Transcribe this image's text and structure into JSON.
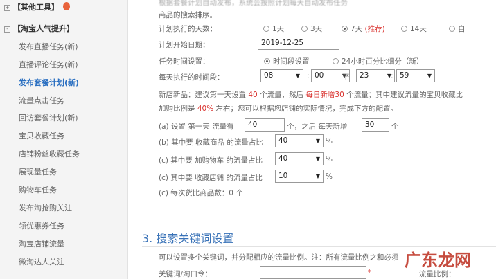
{
  "sidebar": {
    "groups": [
      {
        "label": "【其他工具】",
        "toggle": "+"
      },
      {
        "label": "【淘宝人气提升】",
        "toggle": "-"
      }
    ],
    "items": [
      {
        "label": "发布直播任务(新)"
      },
      {
        "label": "直播评论任务(新)"
      },
      {
        "label": "发布套餐计划(新)"
      },
      {
        "label": "流量点击任务"
      },
      {
        "label": "回访套餐计划(新)"
      },
      {
        "label": "宝贝收藏任务"
      },
      {
        "label": "店铺粉丝收藏任务"
      },
      {
        "label": "展现量任务"
      },
      {
        "label": "购物车任务"
      },
      {
        "label": "发布淘抢购关注"
      },
      {
        "label": "领优惠券任务"
      },
      {
        "label": "淘宝店铺流量"
      },
      {
        "label": "微淘达人关注"
      }
    ],
    "active_item": "发布套餐计划(新)"
  },
  "top_note": {
    "line1": "根据套餐计划自动发布，系统会按照计划每天自动发布任务",
    "line2": "商品的搜索排序。"
  },
  "plan": {
    "days_label": "计划执行的天数：",
    "days_options": [
      {
        "label": "1天",
        "selected": false
      },
      {
        "label": "3天",
        "selected": false
      },
      {
        "label": "7天",
        "tag": "(推荐)",
        "selected": true
      },
      {
        "label": "14天",
        "selected": false
      },
      {
        "label": "自",
        "selected": false
      }
    ],
    "start_date_label": "计划开始日期：",
    "start_date": "2019-12-25",
    "time_setting_label": "任务时间设置：",
    "time_options": [
      {
        "label": "时间段设置",
        "selected": true
      },
      {
        "label": "24小时百分比细分（新）",
        "selected": false
      }
    ],
    "daily_period_label": "每天执行的时间段：",
    "start_hour": "08",
    "start_minute": "00",
    "to_label": "至",
    "end_hour": "23",
    "end_minute": "59"
  },
  "advice": {
    "p1": "新店新品：建议第一天设置",
    "n1": "40",
    "p2": "个流量，然后",
    "red1": "每日新增30",
    "p3": "个流量；其中建议流量的宝贝收藏比",
    "p4": "加购比例是",
    "red2": "40%",
    "p5": "左右；您可以根据您店铺的实际情况，完成下方的配置。"
  },
  "config": {
    "a_prefix": "(a) 设置 第一天 流量有",
    "a_first_day": "40",
    "a_mid": "个，之后 每天新增",
    "a_daily_add": "30",
    "a_suffix": "个",
    "b_label": "(b) 其中要 收藏商品 的流量占比",
    "b_value": "40",
    "c1_label": "(c) 其中要 加购物车 的流量占比",
    "c1_value": "40",
    "c2_label": "(c) 其中要 收藏店铺 的流量占比",
    "c2_value": "10",
    "percent": "%",
    "d_label": "(c) 每次货比商品数：0 个"
  },
  "keywords": {
    "title": "3. 搜索关键词设置",
    "note": "可以设置多个关键词，并分配相应的流量比例。注：所有流量比例之和必须",
    "field_label": "关键词/淘口令：",
    "required_mark": "*",
    "ratio_label": "流量比例："
  },
  "watermark": "广东龙网",
  "colors": {
    "accent": "#2a6fc1",
    "section_title": "#3a73b8",
    "highlight_red": "#d9302c"
  }
}
